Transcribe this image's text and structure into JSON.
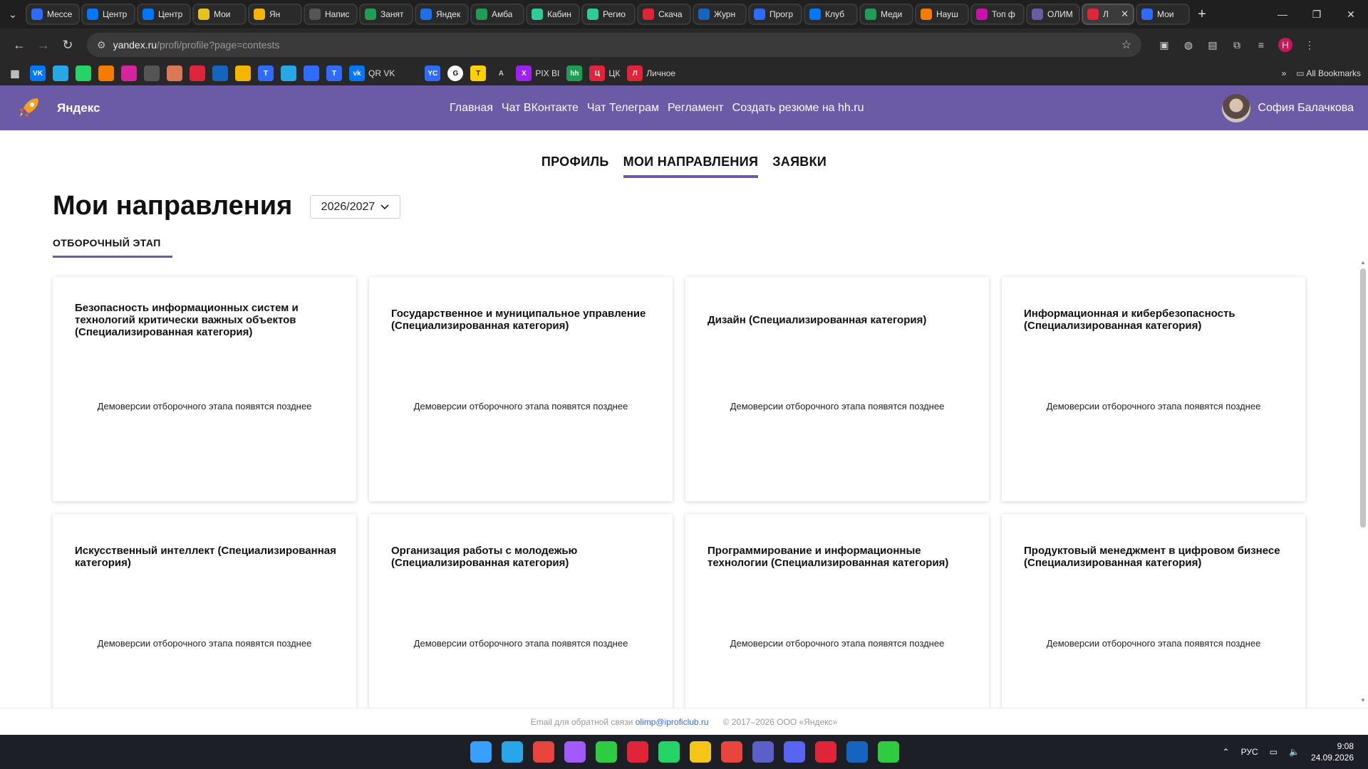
{
  "browser": {
    "tabs": [
      {
        "label": "Мессе",
        "icon": "vk-messenger-icon",
        "color": "#2f6bff"
      },
      {
        "label": "Центр",
        "icon": "vk-icon",
        "color": "#0077ff"
      },
      {
        "label": "Центр",
        "icon": "vk-icon",
        "color": "#0077ff"
      },
      {
        "label": "Мои",
        "icon": "m-icon",
        "color": "#e6c21a"
      },
      {
        "label": "Ян",
        "icon": "yandex-icon",
        "color": "#f5b400"
      },
      {
        "label": "Напис",
        "icon": "chatgpt-icon",
        "color": "#555555"
      },
      {
        "label": "Занят",
        "icon": "sheets-icon",
        "color": "#1f9d55"
      },
      {
        "label": "Яндек",
        "icon": "yandex-icon",
        "color": "#1f6feb"
      },
      {
        "label": "Амба",
        "icon": "sheets-icon",
        "color": "#1f9d55"
      },
      {
        "label": "Кабин",
        "icon": "shield-icon",
        "color": "#2ecc9a"
      },
      {
        "label": "Регио",
        "icon": "shield-icon",
        "color": "#2ecc9a"
      },
      {
        "label": "Скача",
        "icon": "heart-icon",
        "color": "#e0253b"
      },
      {
        "label": "Журн",
        "icon": "journal-icon",
        "color": "#1565c0"
      },
      {
        "label": "Прогр",
        "icon": "docs-icon",
        "color": "#2f6bff"
      },
      {
        "label": "Клуб",
        "icon": "vk-icon",
        "color": "#0077ff"
      },
      {
        "label": "Меди",
        "icon": "sheets-icon",
        "color": "#1f9d55"
      },
      {
        "label": "Науш",
        "icon": "dns-icon",
        "color": "#f57c00"
      },
      {
        "label": "Топ ф",
        "icon": "wb-icon",
        "color": "#cb11ab"
      },
      {
        "label": "ОЛИМ",
        "icon": "rocket-icon",
        "color": "#6b5aa6"
      },
      {
        "label": "Л",
        "icon": "yandex-icon",
        "color": "#e0253b",
        "active": true
      },
      {
        "label": "Мои",
        "icon": "t-icon",
        "color": "#2f6bff"
      }
    ],
    "url_host": "yandex.ru",
    "url_path": "/profi/profile?page=contests",
    "profile_initial": "Н",
    "bookmarks": [
      {
        "icon": "vk-icon",
        "color": "#0077ff",
        "text": "VK"
      },
      {
        "icon": "telegram-icon",
        "color": "#27a7e7",
        "text": ""
      },
      {
        "icon": "whatsapp-icon",
        "color": "#25d366",
        "text": ""
      },
      {
        "icon": "mail-icon",
        "color": "#f57c00",
        "text": ""
      },
      {
        "icon": "instagram-icon",
        "color": "#d6249f",
        "text": ""
      },
      {
        "icon": "chatgpt-icon",
        "color": "#555555",
        "text": ""
      },
      {
        "icon": "claude-icon",
        "color": "#d97757",
        "text": ""
      },
      {
        "icon": "hat-icon",
        "color": "#e0253b",
        "text": ""
      },
      {
        "icon": "bird-icon",
        "color": "#1565c0",
        "text": ""
      },
      {
        "icon": "yandex-icon",
        "color": "#f5b400",
        "text": ""
      },
      {
        "icon": "t-icon",
        "color": "#2f6bff",
        "text": "T"
      },
      {
        "icon": "send-icon",
        "color": "#27a7e7",
        "text": ""
      },
      {
        "icon": "cube-icon",
        "color": "#2f6bff",
        "text": ""
      },
      {
        "icon": "t-icon",
        "color": "#2f6bff",
        "text": "T"
      }
    ],
    "bookmark_qr": "QR VK",
    "bookmark_pix": "PIX BI",
    "bookmark_cz": "ЦК",
    "bookmark_personal": "Личное",
    "bookmark_all": "All Bookmarks"
  },
  "site": {
    "logo_text": "Яндекс",
    "nav": [
      "Главная",
      "Чат ВКонтакте",
      "Чат Телеграм",
      "Регламент",
      "Создать резюме на hh.ru"
    ],
    "user_name": "София Балачкова"
  },
  "page": {
    "tabs": [
      "ПРОФИЛЬ",
      "МОИ НАПРАВЛЕНИЯ",
      "ЗАЯВКИ"
    ],
    "active_tab": 1,
    "title": "Мои направления",
    "year": "2026/2027",
    "stage_tab": "ОТБОРОЧНЫЙ ЭТАП",
    "cards": [
      {
        "title": "Безопасность информационных систем и технологий критически важных объектов (Специализированная категория)",
        "note": "Демоверсии отборочного этапа появятся позднее"
      },
      {
        "title": "Государственное и муниципальное управление (Специализированная категория)",
        "note": "Демоверсии отборочного этапа появятся позднее"
      },
      {
        "title": "Дизайн (Специализированная категория)",
        "note": "Демоверсии отборочного этапа появятся позднее"
      },
      {
        "title": "Информационная и кибербезопасность (Специализированная категория)",
        "note": "Демоверсии отборочного этапа появятся позднее"
      },
      {
        "title": "Искусственный интеллект (Специализированная категория)",
        "note": "Демоверсии отборочного этапа появятся позднее"
      },
      {
        "title": "Организация работы с молодежью (Специализированная категория)",
        "note": "Демоверсии отборочного этапа появятся позднее"
      },
      {
        "title": "Программирование и информационные технологии (Специализированная категория)",
        "note": "Демоверсии отборочного этапа появятся позднее"
      },
      {
        "title": "Продуктовый менеджмент в цифровом бизнесе (Специализированная категория)",
        "note": "Демоверсии отборочного этапа появятся позднее"
      }
    ]
  },
  "footer": {
    "email_label": "Email для обратной связи",
    "email": "olimp@iproficlub.ru",
    "copyright": "© 2017–2026  ООО «Яндекс»"
  },
  "taskbar": {
    "apps": [
      {
        "icon": "windows-start-icon",
        "color": "#3aa0ff"
      },
      {
        "icon": "telegram-icon",
        "color": "#27a7e7"
      },
      {
        "icon": "chrome-icon",
        "color": "#e8453c"
      },
      {
        "icon": "figma-icon",
        "color": "#a259ff"
      },
      {
        "icon": "phone-icon",
        "color": "#2ecc40"
      },
      {
        "icon": "app-icon",
        "color": "#e0253b"
      },
      {
        "icon": "whatsapp-icon",
        "color": "#25d366"
      },
      {
        "icon": "folder-icon",
        "color": "#f5c518"
      },
      {
        "icon": "chrome-active-icon",
        "color": "#e8453c"
      },
      {
        "icon": "teams-icon",
        "color": "#5b5fc7"
      },
      {
        "icon": "discord-icon",
        "color": "#5865f2"
      },
      {
        "icon": "yandex-browser-icon",
        "color": "#e0253b"
      },
      {
        "icon": "bird-icon",
        "color": "#1565c0"
      },
      {
        "icon": "torrent-icon",
        "color": "#2ecc40"
      }
    ],
    "lang": "РУС",
    "time": "9:08",
    "date": "24.09.2026"
  }
}
